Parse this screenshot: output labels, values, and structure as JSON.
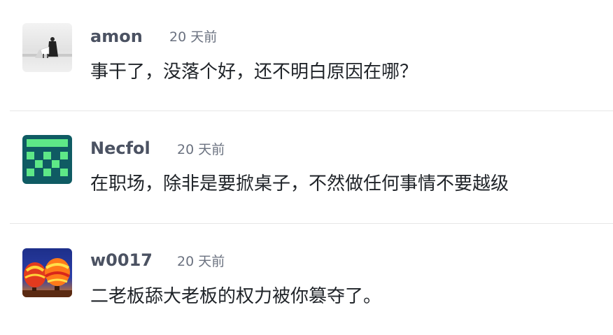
{
  "comments": [
    {
      "author": "amon",
      "time": "20 天前",
      "text": "事干了，没落个好，还不明白原因在哪？",
      "avatar_icon": "grayscale-silhouette-avatar"
    },
    {
      "author": "Necfol",
      "time": "20 天前",
      "text": "在职场，除非是要掀桌子，不然做任何事情不要越级",
      "avatar_icon": "green-pixel-identicon-avatar"
    },
    {
      "author": "w0017",
      "time": "20 天前",
      "text": "二老板舔大老板的权力被你篡夺了。",
      "avatar_icon": "hot-air-balloons-avatar"
    }
  ],
  "colors": {
    "author": "#4b5262",
    "time": "#6b7280",
    "text": "#1f2328",
    "divider": "#e7e7e7",
    "identicon_bg": "#0f5b63",
    "identicon_fg": "#5ee887"
  }
}
